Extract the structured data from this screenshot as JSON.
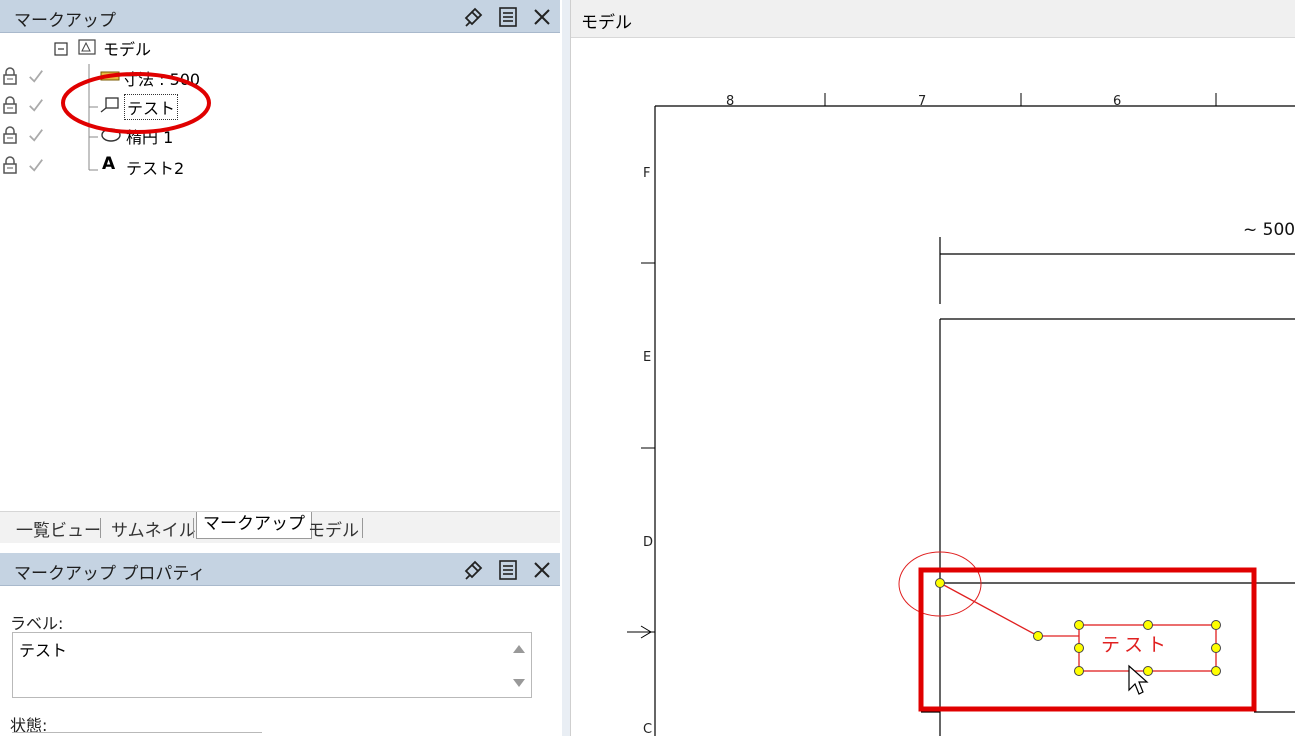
{
  "markup_panel": {
    "title": "マークアップ",
    "tree": {
      "root_label": "モデル",
      "items": [
        {
          "label": "寸法 : 500",
          "icon": "dimension-icon"
        },
        {
          "label": "テスト",
          "icon": "callout-icon"
        },
        {
          "label": "楕円 1",
          "icon": "ellipse-icon"
        },
        {
          "label": "テスト2",
          "icon": "text-a-icon"
        }
      ]
    }
  },
  "bottom_tabs": [
    "一覧ビュー",
    "サムネイル",
    "マークアップ",
    "モデル"
  ],
  "active_tab": "マークアップ",
  "properties_panel": {
    "title": "マークアップ プロパティ",
    "label_field_caption": "ラベル:",
    "label_value": "テスト",
    "state_caption": "状態:"
  },
  "model_view": {
    "title": "モデル",
    "column_labels": [
      "8",
      "7",
      "6"
    ],
    "row_labels": [
      "F",
      "E",
      "D",
      "C"
    ],
    "dimension_text": "~ 500",
    "callout_text": "テスト"
  },
  "colors": {
    "header_bg": "#c5d3e2",
    "markup_red": "#e02020",
    "handle_yellow": "#ffff00",
    "highlight_red": "#e00000"
  }
}
